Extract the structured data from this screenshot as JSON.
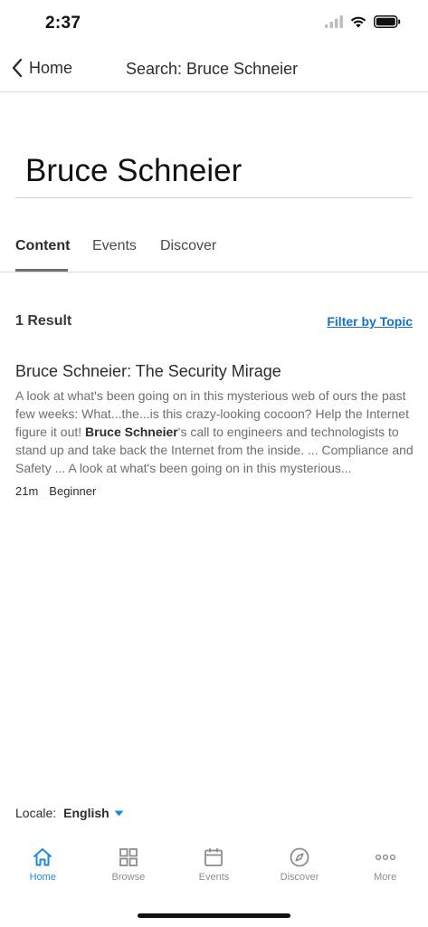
{
  "status": {
    "time": "2:37"
  },
  "nav": {
    "back_label": "Home",
    "title": "Search: Bruce Schneier"
  },
  "search": {
    "query": "Bruce Schneier"
  },
  "tabs": [
    {
      "label": "Content",
      "active": true
    },
    {
      "label": "Events",
      "active": false
    },
    {
      "label": "Discover",
      "active": false
    }
  ],
  "results": {
    "count_text": "1 Result",
    "filter_label": "Filter by Topic",
    "items": [
      {
        "title": "Bruce Schneier: The Security Mirage",
        "desc_before": "A look at what's been going on in this mysterious web of ours the past few weeks: What...the...is this crazy-looking cocoon? Help the Internet figure it out! ",
        "desc_bold": "Bruce Schneier",
        "desc_after": "'s call to engineers and technologists to stand up and take back the Internet from the inside. ... Compliance and Safety ... A look at what's been going on in this mysterious...",
        "duration": "21m",
        "level": "Beginner"
      }
    ]
  },
  "locale": {
    "label": "Locale:",
    "value": "English"
  },
  "bottom_nav": [
    {
      "label": "Home",
      "icon": "home-icon",
      "active": true
    },
    {
      "label": "Browse",
      "icon": "grid-icon",
      "active": false
    },
    {
      "label": "Events",
      "icon": "calendar-icon",
      "active": false
    },
    {
      "label": "Discover",
      "icon": "compass-icon",
      "active": false
    },
    {
      "label": "More",
      "icon": "more-dots-icon",
      "active": false
    }
  ],
  "colors": {
    "accent": "#1e88e5",
    "link": "#1673c9",
    "inactive": "#8c8c8c"
  }
}
